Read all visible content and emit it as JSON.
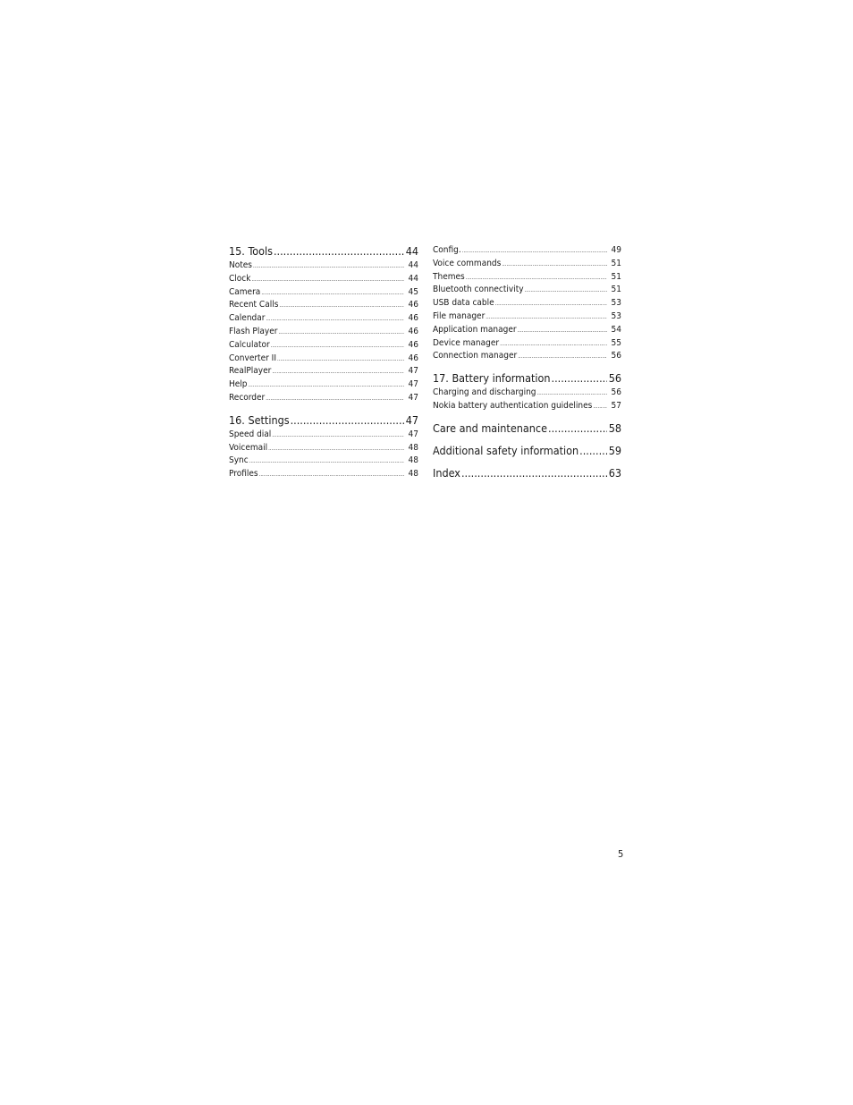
{
  "left_column": [
    {
      "title": "15. Tools",
      "page": "44",
      "entries": [
        {
          "label": "Notes",
          "page": "44"
        },
        {
          "label": "Clock",
          "page": "44"
        },
        {
          "label": "Camera",
          "page": "45"
        },
        {
          "label": "Recent Calls",
          "page": "46"
        },
        {
          "label": "Calendar",
          "page": "46"
        },
        {
          "label": "Flash Player",
          "page": "46"
        },
        {
          "label": "Calculator",
          "page": "46"
        },
        {
          "label": "Converter II",
          "page": "46"
        },
        {
          "label": "RealPlayer",
          "page": "47"
        },
        {
          "label": "Help",
          "page": "47"
        },
        {
          "label": "Recorder",
          "page": "47"
        }
      ]
    },
    {
      "title": "16. Settings",
      "page": "47",
      "entries": [
        {
          "label": "Speed dial",
          "page": "47"
        },
        {
          "label": "Voicemail",
          "page": "48"
        },
        {
          "label": "Sync",
          "page": "48"
        },
        {
          "label": "Profiles",
          "page": "48"
        }
      ]
    }
  ],
  "right_column": {
    "continued_entries": [
      {
        "label": "Config.",
        "page": "49"
      },
      {
        "label": "Voice commands",
        "page": "51"
      },
      {
        "label": "Themes",
        "page": "51"
      },
      {
        "label": "Bluetooth connectivity",
        "page": "51"
      },
      {
        "label": "USB data cable",
        "page": "53"
      },
      {
        "label": "File manager",
        "page": "53"
      },
      {
        "label": "Application manager",
        "page": "54"
      },
      {
        "label": "Device manager",
        "page": "55"
      },
      {
        "label": "Connection manager",
        "page": "56"
      }
    ],
    "battery": {
      "title": "17. Battery information",
      "page": "56",
      "entries": [
        {
          "label": "Charging and discharging",
          "page": "56"
        },
        {
          "label": "Nokia battery authentication guidelines",
          "page": "57"
        }
      ]
    },
    "care": {
      "title": "Care and maintenance",
      "page": "58"
    },
    "safety": {
      "title": "Additional safety information",
      "page": "59"
    },
    "index": {
      "title": "Index",
      "page": "63"
    }
  },
  "page_number": "5"
}
